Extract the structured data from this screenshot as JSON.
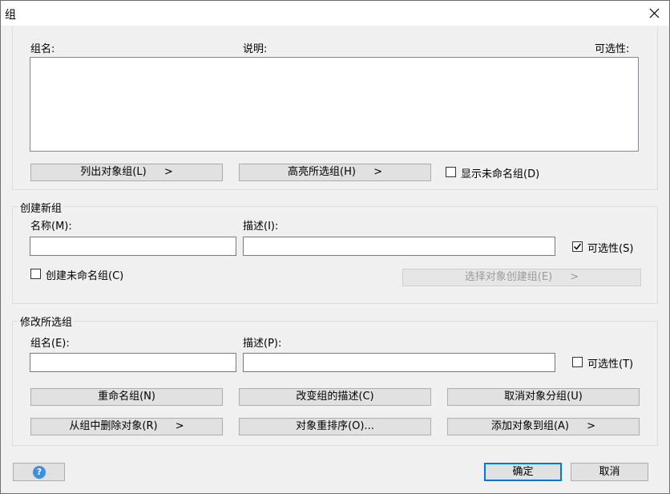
{
  "window": {
    "title": "组"
  },
  "group_list": {
    "col_name": "组名:",
    "col_desc": "说明:",
    "col_selectable": "可选性:",
    "list_objects_label": "列出对象组(L)",
    "list_objects_arrow": ">",
    "highlight_label": "高亮所选组(H)",
    "highlight_arrow": ">",
    "show_unnamed_label": "显示未命名组(D)"
  },
  "create_group": {
    "section_title": "创建新组",
    "name_label": "名称(M):",
    "desc_label": "描述(I):",
    "name_value": "",
    "desc_value": "",
    "selectable_label": "可选性(S)",
    "selectable_checked": true,
    "create_unnamed_label": "创建未命名组(C)",
    "create_unnamed_checked": false,
    "select_create_label": "选择对象创建组(E)",
    "select_create_arrow": ">"
  },
  "modify_group": {
    "section_title": "修改所选组",
    "name_label": "组名(E):",
    "desc_label": "描述(P):",
    "name_value": "",
    "desc_value": "",
    "selectable_label": "可选性(T)",
    "selectable_checked": false,
    "rename_label": "重命名组(N)",
    "change_desc_label": "改变组的描述(C)",
    "ungroup_label": "取消对象分组(U)",
    "remove_label": "从组中删除对象(R)",
    "remove_arrow": ">",
    "reorder_label": "对象重排序(O)...",
    "add_label": "添加对象到组(A)",
    "add_arrow": ">"
  },
  "footer": {
    "help_icon": "?",
    "ok_label": "确定",
    "cancel_label": "取消"
  }
}
